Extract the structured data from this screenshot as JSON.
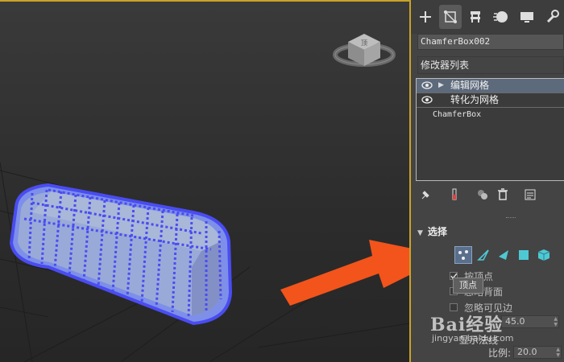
{
  "viewport": {
    "viewcube_label": "顶"
  },
  "command_panel": {
    "tabs": [
      {
        "id": "create",
        "icon": "plus-icon"
      },
      {
        "id": "modify",
        "icon": "modify-icon"
      },
      {
        "id": "hierarchy",
        "icon": "hierarchy-icon"
      },
      {
        "id": "motion",
        "icon": "motion-icon"
      },
      {
        "id": "display",
        "icon": "display-icon"
      },
      {
        "id": "utilities",
        "icon": "wrench-icon"
      }
    ],
    "object_name": "ChamferBox002",
    "modifier_list_label": "修改器列表",
    "stack": [
      {
        "label": "编辑网格",
        "selected": true,
        "visible": true,
        "expandable": true
      },
      {
        "label": "转化为网格",
        "selected": false,
        "visible": true,
        "expandable": false
      },
      {
        "label": "ChamferBox",
        "selected": false,
        "visible": false,
        "expandable": false
      }
    ],
    "selection_rollout": {
      "title": "选择",
      "modes": [
        "vertex",
        "edge",
        "face",
        "polygon",
        "element"
      ],
      "active_mode": "vertex",
      "tooltip": "顶点",
      "options": [
        {
          "label": "按顶点",
          "checked": true
        },
        {
          "label": "忽略背面",
          "checked": false
        },
        {
          "label": "忽略可见边",
          "checked": false
        }
      ],
      "planar_threshold": "45.0",
      "show_normals_label": "显示法线",
      "scale_label": "比例:",
      "scale_value": "20.0"
    }
  },
  "annotation": {
    "arrow_color": "#f2541b"
  },
  "watermark": {
    "big": "Bai经验",
    "small": "jingyan.baidu.com"
  },
  "colors": {
    "accent_border": "#c9a227",
    "selection_blue": "#5d6a7c",
    "vertex_blue": "#4a4cf2"
  }
}
